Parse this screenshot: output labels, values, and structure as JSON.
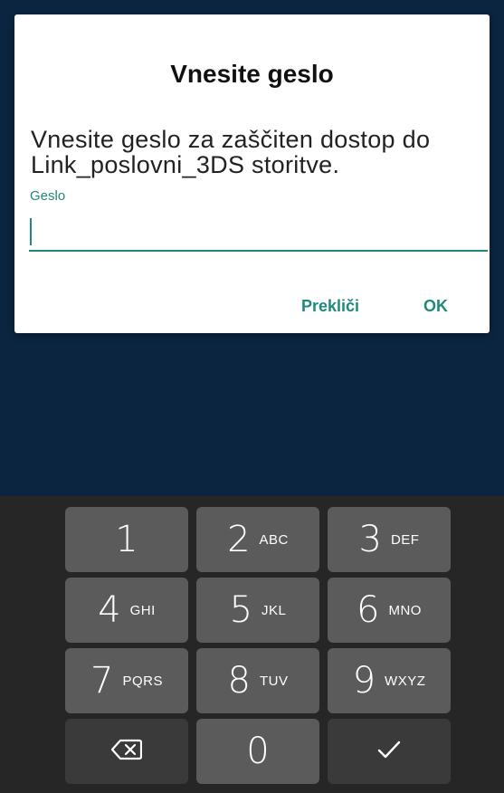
{
  "dialog": {
    "title": "Vnesite geslo",
    "message": "Vnesite geslo za zaščiten dostop do Link_poslovni_3DS storitve.",
    "field_label": "Geslo",
    "field_value": "",
    "cancel_label": "Prekliči",
    "ok_label": "OK"
  },
  "keyboard": {
    "keys": [
      {
        "num": "1",
        "letters": ""
      },
      {
        "num": "2",
        "letters": "ABC"
      },
      {
        "num": "3",
        "letters": "DEF"
      },
      {
        "num": "4",
        "letters": "GHI"
      },
      {
        "num": "5",
        "letters": "JKL"
      },
      {
        "num": "6",
        "letters": "MNO"
      },
      {
        "num": "7",
        "letters": "PQRS"
      },
      {
        "num": "8",
        "letters": "TUV"
      },
      {
        "num": "9",
        "letters": "WXYZ"
      },
      {
        "num": "0",
        "letters": ""
      }
    ],
    "backspace_icon": "backspace-icon",
    "done_icon": "checkmark-icon"
  },
  "colors": {
    "accent": "#1f8a7a",
    "backdrop": "#0b2540",
    "keyboard_bg": "#262626",
    "key_bg": "#5b5b5b",
    "key_dark_bg": "#3a3a3a"
  }
}
